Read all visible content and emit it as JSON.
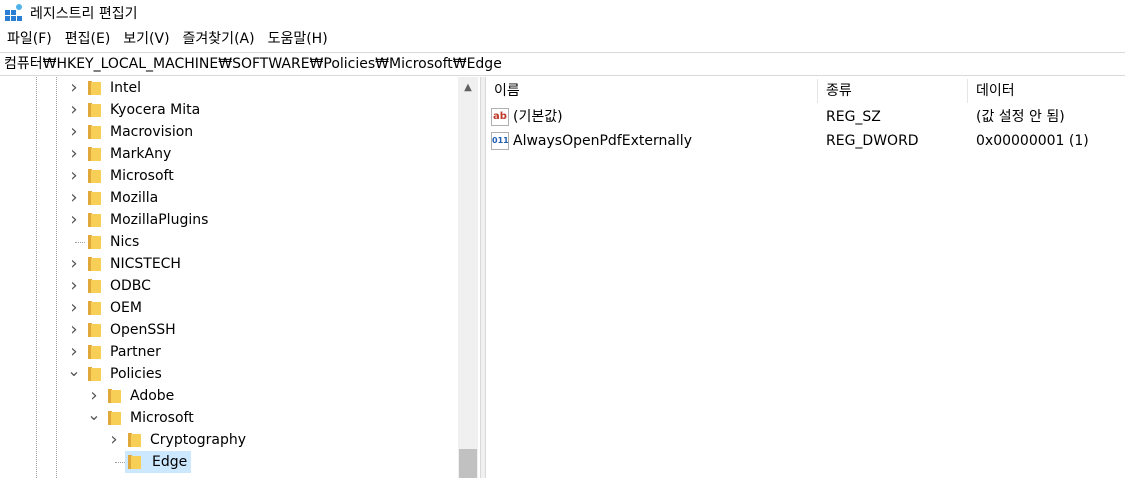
{
  "window": {
    "title": "레지스트리 편집기",
    "icon": "registry-editor-icon"
  },
  "menu": [
    {
      "label": "파일(F)"
    },
    {
      "label": "편집(E)"
    },
    {
      "label": "보기(V)"
    },
    {
      "label": "즐겨찾기(A)"
    },
    {
      "label": "도움말(H)"
    }
  ],
  "address": {
    "path": "컴퓨터₩HKEY_LOCAL_MACHINE₩SOFTWARE₩Policies₩Microsoft₩Edge"
  },
  "tree": {
    "items": [
      {
        "label": "Intel",
        "expander": "collapsed",
        "level": 0
      },
      {
        "label": "Kyocera Mita",
        "expander": "collapsed",
        "level": 0
      },
      {
        "label": "Macrovision",
        "expander": "collapsed",
        "level": 0
      },
      {
        "label": "MarkAny",
        "expander": "collapsed",
        "level": 0
      },
      {
        "label": "Microsoft",
        "expander": "collapsed",
        "level": 0
      },
      {
        "label": "Mozilla",
        "expander": "collapsed",
        "level": 0
      },
      {
        "label": "MozillaPlugins",
        "expander": "collapsed",
        "level": 0
      },
      {
        "label": "Nics",
        "expander": "none",
        "level": 0
      },
      {
        "label": "NICSTECH",
        "expander": "collapsed",
        "level": 0
      },
      {
        "label": "ODBC",
        "expander": "collapsed",
        "level": 0
      },
      {
        "label": "OEM",
        "expander": "collapsed",
        "level": 0
      },
      {
        "label": "OpenSSH",
        "expander": "collapsed",
        "level": 0
      },
      {
        "label": "Partner",
        "expander": "collapsed",
        "level": 0
      },
      {
        "label": "Policies",
        "expander": "expanded",
        "level": 0
      },
      {
        "label": "Adobe",
        "expander": "collapsed",
        "level": 1
      },
      {
        "label": "Microsoft",
        "expander": "expanded",
        "level": 1
      },
      {
        "label": "Cryptography",
        "expander": "collapsed",
        "level": 2
      },
      {
        "label": "Edge",
        "expander": "none",
        "level": 2,
        "selected": true
      }
    ]
  },
  "list": {
    "columns": {
      "name": "이름",
      "type": "종류",
      "data": "데이터"
    },
    "rows": [
      {
        "name": "(기본값)",
        "type": "REG_SZ",
        "data": "(값 설정 안 됨)",
        "icon": "string-value-icon",
        "icon_text": "ab"
      },
      {
        "name": "AlwaysOpenPdfExternally",
        "type": "REG_DWORD",
        "data": "0x00000001 (1)",
        "icon": "dword-value-icon",
        "icon_text": "011"
      }
    ]
  },
  "colors": {
    "selection": "#cce8ff",
    "folder": "#f7cf57",
    "folder_dark": "#e0a83a"
  }
}
